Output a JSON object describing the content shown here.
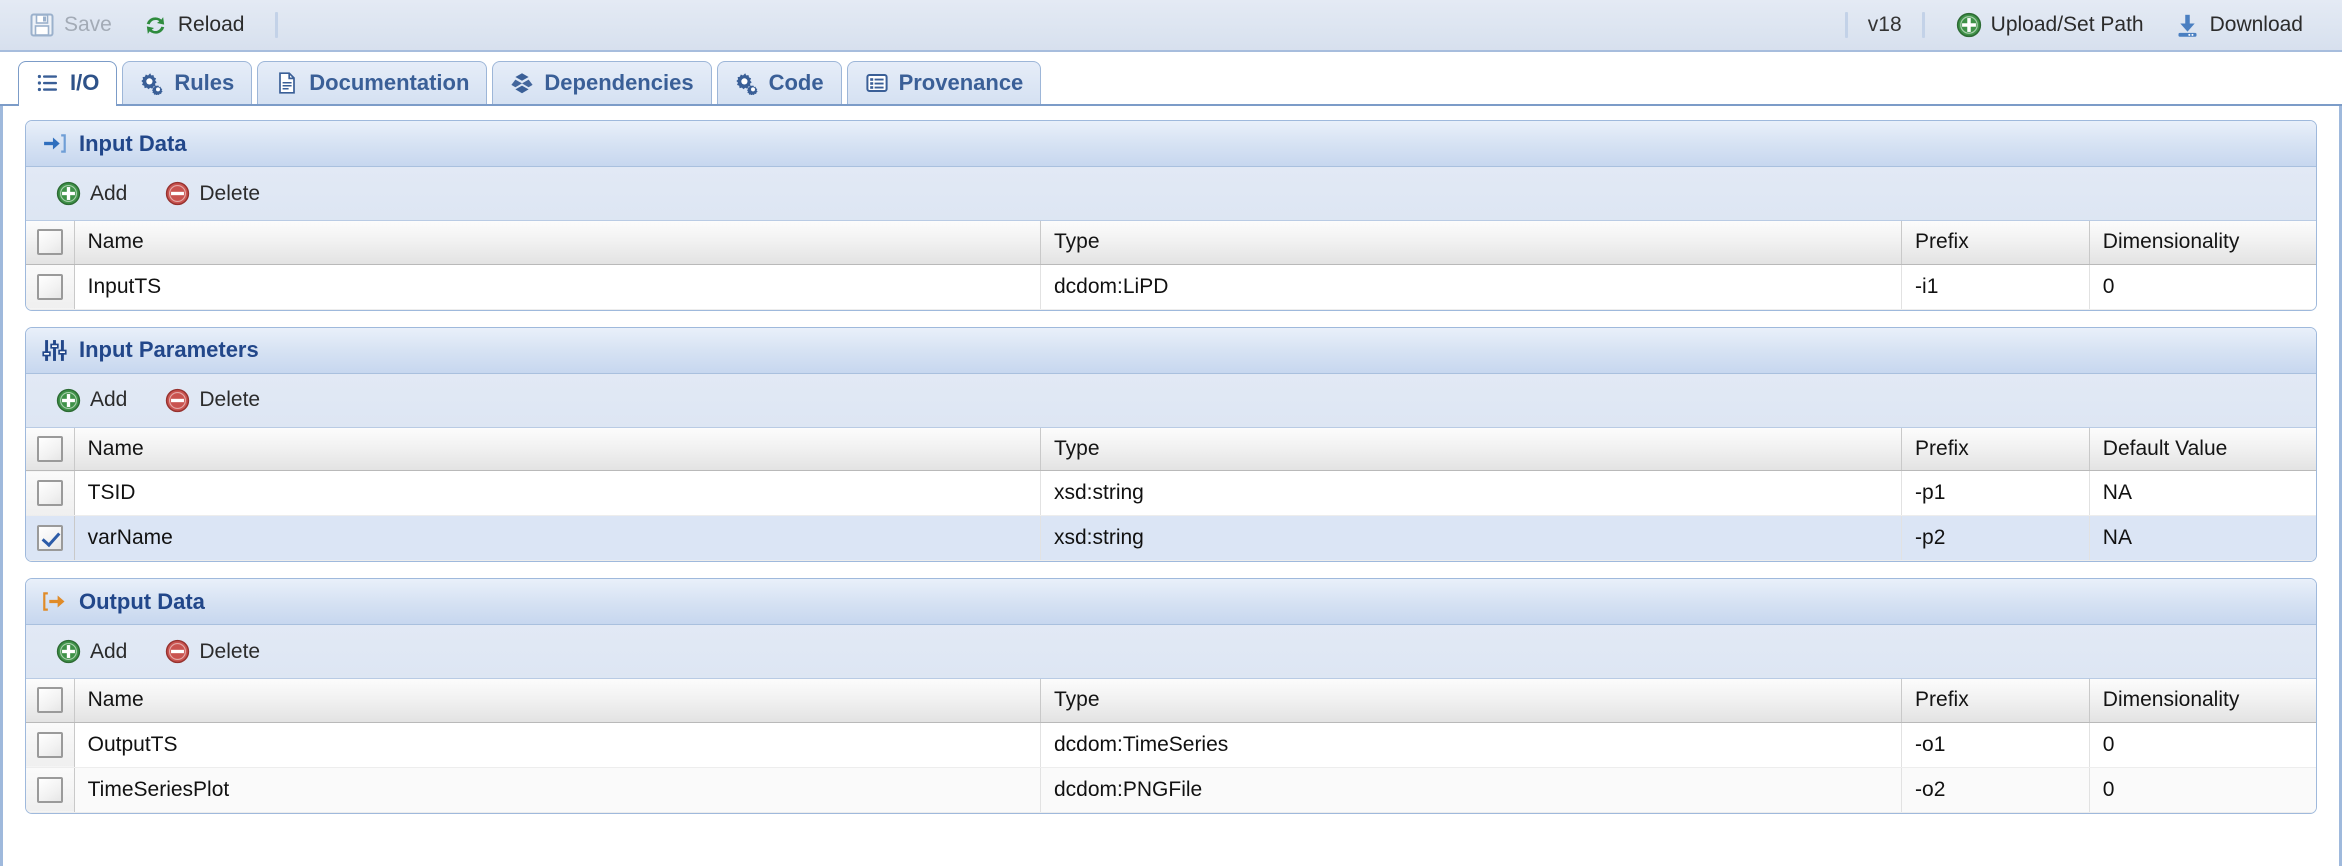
{
  "toolbar": {
    "save_label": "Save",
    "reload_label": "Reload",
    "version_label": "v18",
    "upload_label": "Upload/Set Path",
    "download_label": "Download"
  },
  "tabs": [
    {
      "label": "I/O",
      "icon": "list-icon",
      "active": true
    },
    {
      "label": "Rules",
      "icon": "gears-icon",
      "active": false
    },
    {
      "label": "Documentation",
      "icon": "document-icon",
      "active": false
    },
    {
      "label": "Dependencies",
      "icon": "dependencies-icon",
      "active": false
    },
    {
      "label": "Code",
      "icon": "gears-icon",
      "active": false
    },
    {
      "label": "Provenance",
      "icon": "list-panel-icon",
      "active": false
    }
  ],
  "common": {
    "add_label": "Add",
    "delete_label": "Delete"
  },
  "sections": [
    {
      "title": "Input Data",
      "icon": "arrow-into-bracket-icon",
      "icon_color": "#2f6fbe",
      "columns": [
        "Name",
        "Type",
        "Prefix",
        "Dimensionality"
      ],
      "rows": [
        {
          "checked": false,
          "selected": false,
          "name": "InputTS",
          "type": "dcdom:LiPD",
          "prefix": "-i1",
          "last": "0"
        }
      ]
    },
    {
      "title": "Input Parameters",
      "icon": "sliders-icon",
      "icon_color": "#22478a",
      "columns": [
        "Name",
        "Type",
        "Prefix",
        "Default Value"
      ],
      "rows": [
        {
          "checked": false,
          "selected": false,
          "name": "TSID",
          "type": "xsd:string",
          "prefix": "-p1",
          "last": "NA"
        },
        {
          "checked": true,
          "selected": true,
          "name": "varName",
          "type": "xsd:string",
          "prefix": "-p2",
          "last": "NA"
        }
      ]
    },
    {
      "title": "Output Data",
      "icon": "arrow-out-of-bracket-icon",
      "icon_color": "#e08b28",
      "columns": [
        "Name",
        "Type",
        "Prefix",
        "Dimensionality"
      ],
      "rows": [
        {
          "checked": false,
          "selected": false,
          "name": "OutputTS",
          "type": "dcdom:TimeSeries",
          "prefix": "-o1",
          "last": "0"
        },
        {
          "checked": false,
          "selected": false,
          "name": "TimeSeriesPlot",
          "type": "dcdom:PNGFile",
          "prefix": "-o2",
          "last": "0"
        }
      ]
    }
  ],
  "colors": {
    "accent": "#22478a",
    "tab_text": "#3a5f97",
    "add_green": "#3f9248",
    "delete_red": "#c9534f",
    "panel_border": "#9fb9dc"
  }
}
